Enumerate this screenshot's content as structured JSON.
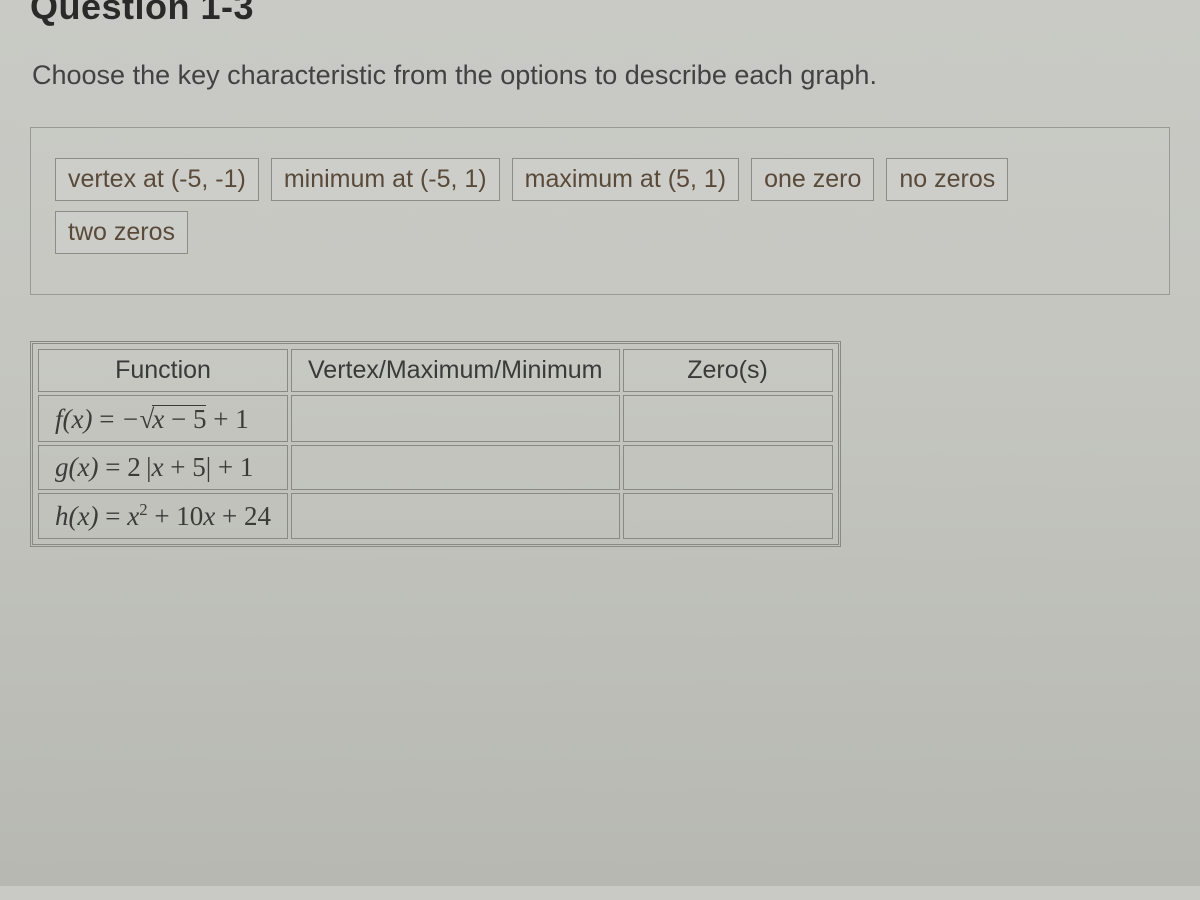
{
  "title_cut": "Question 1-3",
  "instruction": "Choose the key characteristic from the options to describe each graph.",
  "options": {
    "opt0": "vertex at (-5, -1)",
    "opt1": "minimum at (-5, 1)",
    "opt2": "maximum at (5, 1)",
    "opt3": "one zero",
    "opt4": "no zeros",
    "opt5": "two zeros"
  },
  "table": {
    "headers": {
      "c0": "Function",
      "c1": "Vertex/Maximum/Minimum",
      "c2": "Zero(s)"
    },
    "rows": {
      "r0": {
        "func_plain": "f(x) = -√(x - 5) + 1"
      },
      "r1": {
        "func_plain": "g(x) = 2|x + 5| + 1"
      },
      "r2": {
        "func_plain": "h(x) = x² + 10x + 24"
      }
    }
  }
}
